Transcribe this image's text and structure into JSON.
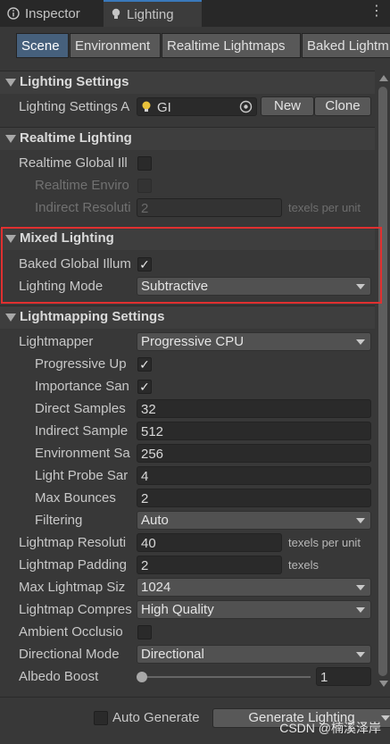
{
  "window_tabs": [
    {
      "label": "Inspector",
      "icon": "info-icon"
    },
    {
      "label": "Lighting",
      "icon": "lightbulb-icon"
    }
  ],
  "menu_icon": "⋮",
  "subtabs": [
    "Scene",
    "Environment",
    "Realtime Lightmaps",
    "Baked Lightm"
  ],
  "lighting_settings": {
    "title": "Lighting Settings",
    "asset_label": "Lighting Settings A",
    "asset_value": "GI",
    "new_button": "New",
    "clone_button": "Clone"
  },
  "realtime_lighting": {
    "title": "Realtime Lighting",
    "gi_label": "Realtime Global Ill",
    "env_label": "Realtime Enviro",
    "indirect_label": "Indirect Resoluti",
    "indirect_value": "2",
    "indirect_unit": "texels per unit"
  },
  "mixed_lighting": {
    "title": "Mixed Lighting",
    "baked_label": "Baked Global Illum",
    "baked_check": "✓",
    "mode_label": "Lighting Mode",
    "mode_value": "Subtractive"
  },
  "lightmapping": {
    "title": "Lightmapping Settings",
    "lightmapper_label": "Lightmapper",
    "lightmapper_value": "Progressive CPU",
    "progressive_label": "Progressive Up",
    "importance_label": "Importance San",
    "direct_label": "Direct Samples",
    "direct_value": "32",
    "indirect_label": "Indirect Sample",
    "indirect_value": "512",
    "environment_label": "Environment Sa",
    "environment_value": "256",
    "probe_label": "Light Probe Sar",
    "probe_value": "4",
    "bounces_label": "Max Bounces",
    "bounces_value": "2",
    "filtering_label": "Filtering",
    "filtering_value": "Auto",
    "resolution_label": "Lightmap Resoluti",
    "resolution_value": "40",
    "resolution_unit": "texels per unit",
    "padding_label": "Lightmap Padding",
    "padding_value": "2",
    "padding_unit": "texels",
    "max_size_label": "Max Lightmap Siz",
    "max_size_value": "1024",
    "compress_label": "Lightmap Compres",
    "compress_value": "High Quality",
    "ao_label": "Ambient Occlusio",
    "directional_label": "Directional Mode",
    "directional_value": "Directional",
    "albedo_label": "Albedo Boost",
    "albedo_value": "1",
    "check": "✓"
  },
  "footer": {
    "auto_generate": "Auto Generate",
    "generate_button": "Generate Lighting",
    "watermark": "CSDN @楠溪泽岸"
  }
}
